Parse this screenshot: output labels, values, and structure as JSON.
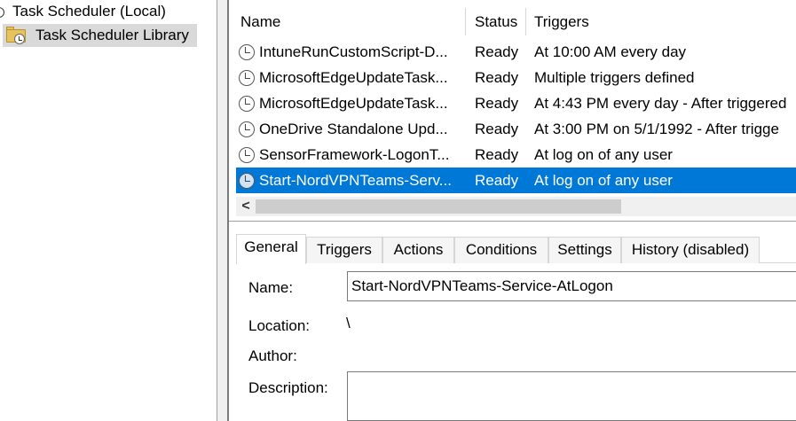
{
  "tree": {
    "root_label": "Task Scheduler (Local)",
    "library_label": "Task Scheduler Library"
  },
  "task_list": {
    "columns": [
      "Name",
      "Status",
      "Triggers"
    ],
    "rows": [
      {
        "name": "IntuneRunCustomScript-D...",
        "status": "Ready",
        "triggers": "At 10:00 AM every day",
        "selected": false
      },
      {
        "name": "MicrosoftEdgeUpdateTask...",
        "status": "Ready",
        "triggers": "Multiple triggers defined",
        "selected": false
      },
      {
        "name": "MicrosoftEdgeUpdateTask...",
        "status": "Ready",
        "triggers": "At 4:43 PM every day - After triggered",
        "selected": false
      },
      {
        "name": "OneDrive Standalone Upd...",
        "status": "Ready",
        "triggers": "At 3:00 PM on 5/1/1992 - After trigge",
        "selected": false
      },
      {
        "name": "SensorFramework-LogonT...",
        "status": "Ready",
        "triggers": "At log on of any user",
        "selected": false
      },
      {
        "name": "Start-NordVPNTeams-Serv...",
        "status": "Ready",
        "triggers": "At log on of any user",
        "selected": true
      }
    ],
    "scroll_left_glyph": "<"
  },
  "details": {
    "tabs": [
      "General",
      "Triggers",
      "Actions",
      "Conditions",
      "Settings",
      "History (disabled)"
    ],
    "active_tab": "General",
    "labels": {
      "name": "Name:",
      "location": "Location:",
      "author": "Author:",
      "description": "Description:"
    },
    "values": {
      "name": "Start-NordVPNTeams-Service-AtLogon",
      "location": "\\",
      "author": "",
      "description": ""
    }
  },
  "colors": {
    "selection": "#0078d7",
    "tree_selection": "#d9d9d9"
  }
}
